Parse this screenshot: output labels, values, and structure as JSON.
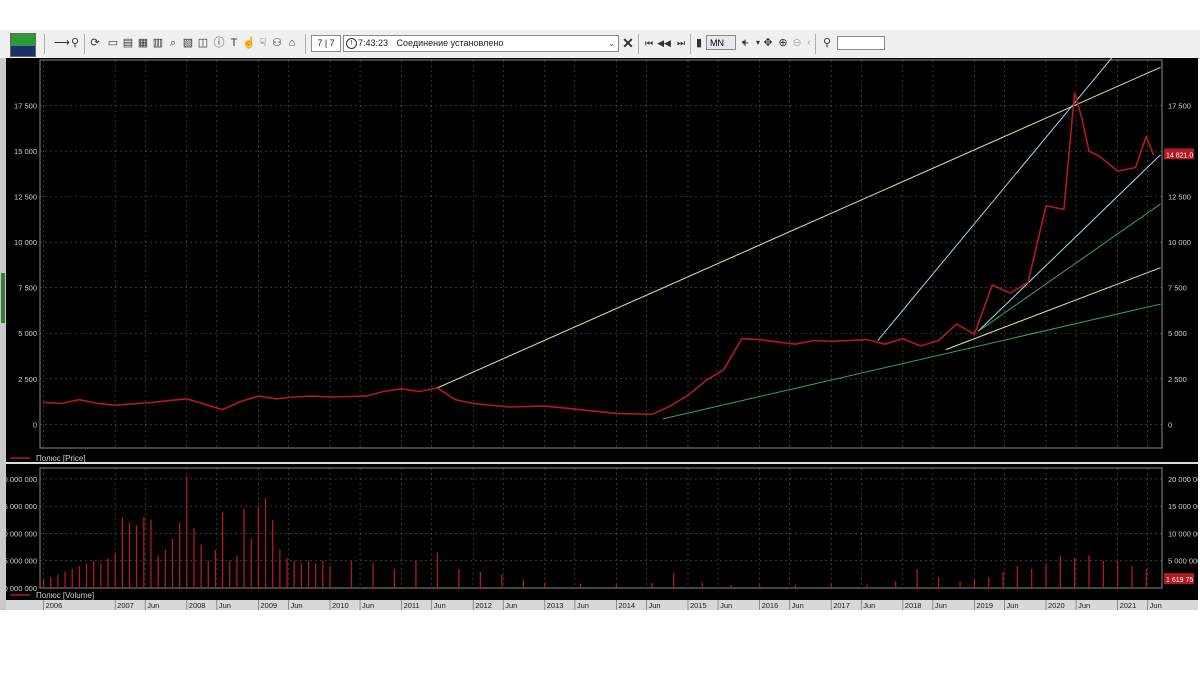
{
  "toolbar": {
    "counter": "7 | 7",
    "time": "7:43:23",
    "status_message": "Соединение установлено",
    "timeframe": "MN"
  },
  "colors": {
    "price_line": "#b01a22",
    "volume_bars": "#b01a22",
    "grid": "#5a5a5a",
    "axis_text": "#d0d0d0",
    "trend_yellow": "#e8e0a0",
    "trend_cyan": "#a0d8e8",
    "trend_green": "#3aa060",
    "price_badge": "#b01a22"
  },
  "chart_data": [
    {
      "type": "line",
      "legend": "Полюс [Price]",
      "y_ticks": [
        "0",
        "2 500",
        "5 000",
        "7 500",
        "10 000",
        "12 500",
        "15 000",
        "17 500"
      ],
      "y_tick_values": [
        0,
        2500,
        5000,
        7500,
        10000,
        12500,
        15000,
        17500
      ],
      "ylim": [
        -1300,
        20000
      ],
      "current_price_label": "14 821.0",
      "series": [
        {
          "x": [
            2006.0,
            2006.25,
            2006.5,
            2006.75,
            2007.0,
            2007.5,
            2007.75,
            2008.0,
            2008.25,
            2008.5,
            2008.75,
            2009.0,
            2009.25,
            2009.5,
            2009.75,
            2010.0,
            2010.5,
            2010.75,
            2011.0,
            2011.25,
            2011.5,
            2011.75,
            2012.0,
            2012.5,
            2013.0,
            2013.5,
            2014.0,
            2014.5,
            2014.75,
            2015.0,
            2015.25,
            2015.5,
            2015.75,
            2016.0,
            2016.5,
            2016.75,
            2017.0,
            2017.5,
            2017.75,
            2018.0,
            2018.25,
            2018.5,
            2018.75,
            2019.0,
            2019.25,
            2019.5,
            2019.75,
            2020.0,
            2020.25,
            2020.4,
            2020.5,
            2020.6,
            2020.75,
            2021.0,
            2021.25,
            2021.4,
            2021.5
          ],
          "y": [
            1200,
            1150,
            1350,
            1150,
            1050,
            1200,
            1300,
            1400,
            1100,
            800,
            1250,
            1550,
            1400,
            1500,
            1550,
            1500,
            1550,
            1800,
            1950,
            1800,
            2000,
            1350,
            1150,
            950,
            1000,
            800,
            600,
            550,
            1000,
            1600,
            2400,
            3000,
            4700,
            4650,
            4400,
            4600,
            4550,
            4650,
            4400,
            4700,
            4300,
            4600,
            5500,
            4950,
            7650,
            7200,
            7800,
            12000,
            11800,
            18200,
            16800,
            15000,
            14700,
            13900,
            14100,
            15800,
            14820
          ]
        }
      ],
      "trendlines": [
        {
          "color": "yellow",
          "from": [
            2011.5,
            2000
          ],
          "to": [
            2021.6,
            19600
          ]
        },
        {
          "color": "cyan",
          "from": [
            2017.65,
            4600
          ],
          "to": [
            2021.0,
            20500
          ]
        },
        {
          "color": "cyan",
          "from": [
            2019.05,
            5100
          ],
          "to": [
            2021.6,
            14800
          ]
        },
        {
          "color": "green",
          "from": [
            2019.05,
            5100
          ],
          "to": [
            2021.6,
            12100
          ]
        },
        {
          "color": "yellow",
          "from": [
            2018.6,
            4100
          ],
          "to": [
            2021.6,
            8600
          ]
        },
        {
          "color": "green",
          "from": [
            2014.65,
            300
          ],
          "to": [
            2021.6,
            6600
          ]
        }
      ]
    },
    {
      "type": "bar",
      "legend": "Полюс [Volume]",
      "y_ticks_left": [
        "0 000 000",
        "5 000 000",
        "0 000 000",
        "5 000 000",
        "0 000 000"
      ],
      "y_ticks_right": [
        "5 000 000",
        "10 000 000",
        "15 000 000",
        "20 000 000"
      ],
      "y_tick_values": [
        5000000,
        10000000,
        15000000,
        20000000
      ],
      "current_volume_label": "1 619 75",
      "ylim": [
        0,
        22000000
      ],
      "x": [
        2006.0,
        2006.1,
        2006.2,
        2006.3,
        2006.4,
        2006.5,
        2006.6,
        2006.7,
        2006.8,
        2006.9,
        2007.0,
        2007.1,
        2007.2,
        2007.3,
        2007.4,
        2007.5,
        2007.6,
        2007.7,
        2007.8,
        2007.9,
        2008.0,
        2008.1,
        2008.2,
        2008.3,
        2008.4,
        2008.5,
        2008.6,
        2008.7,
        2008.8,
        2008.9,
        2009.0,
        2009.1,
        2009.2,
        2009.3,
        2009.4,
        2009.5,
        2009.6,
        2009.7,
        2009.8,
        2009.9,
        2010.0,
        2010.3,
        2010.6,
        2010.9,
        2011.2,
        2011.5,
        2011.8,
        2012.1,
        2012.4,
        2012.7,
        2013.0,
        2013.5,
        2014.0,
        2014.5,
        2014.8,
        2015.2,
        2015.6,
        2016.0,
        2016.5,
        2017.0,
        2017.5,
        2017.9,
        2018.2,
        2018.5,
        2018.8,
        2019.0,
        2019.2,
        2019.4,
        2019.6,
        2019.8,
        2020.0,
        2020.2,
        2020.4,
        2020.6,
        2020.8,
        2021.0,
        2021.2,
        2021.4
      ],
      "values": [
        1500000,
        2000000,
        2500000,
        3000000,
        3500000,
        4000000,
        4500000,
        5000000,
        4500000,
        5500000,
        6500000,
        13000000,
        12000000,
        11500000,
        13000000,
        12500000,
        6000000,
        7000000,
        9000000,
        12000000,
        20500000,
        11000000,
        8000000,
        5000000,
        7000000,
        14000000,
        5000000,
        6000000,
        14500000,
        9000000,
        15000000,
        16500000,
        12500000,
        7000000,
        5500000,
        5000000,
        4500000,
        5000000,
        4500000,
        5000000,
        4000000,
        5000000,
        4500000,
        3500000,
        5000000,
        6500000,
        3500000,
        3000000,
        2500000,
        1500000,
        1000000,
        800000,
        600000,
        900000,
        2800000,
        1000000,
        600000,
        500000,
        600000,
        800000,
        700000,
        1200000,
        3500000,
        2000000,
        1200000,
        1500000,
        2000000,
        3000000,
        4000000,
        3500000,
        4500000,
        6000000,
        5500000,
        6000000,
        5000000,
        5000000,
        4000000,
        3500000
      ]
    }
  ],
  "x_axis": {
    "labels": [
      "2006",
      "2007",
      "Jun",
      "2008",
      "Jun",
      "2009",
      "Jun",
      "2010",
      "Jun",
      "2011",
      "Jun",
      "2012",
      "Jun",
      "2013",
      "Jun",
      "2014",
      "Jun",
      "2015",
      "Jun",
      "2016",
      "Jun",
      "2017",
      "Jun",
      "2018",
      "Jun",
      "2019",
      "Jun",
      "2020",
      "Jun",
      "2021",
      "Jun"
    ],
    "values": [
      2006.0,
      2007.0,
      2007.42,
      2008.0,
      2008.42,
      2009.0,
      2009.42,
      2010.0,
      2010.42,
      2011.0,
      2011.42,
      2012.0,
      2012.42,
      2013.0,
      2013.42,
      2014.0,
      2014.42,
      2015.0,
      2015.42,
      2016.0,
      2016.42,
      2017.0,
      2017.42,
      2018.0,
      2018.42,
      2019.0,
      2019.42,
      2020.0,
      2020.42,
      2021.0,
      2021.42
    ],
    "range": [
      2005.95,
      2021.62
    ]
  }
}
